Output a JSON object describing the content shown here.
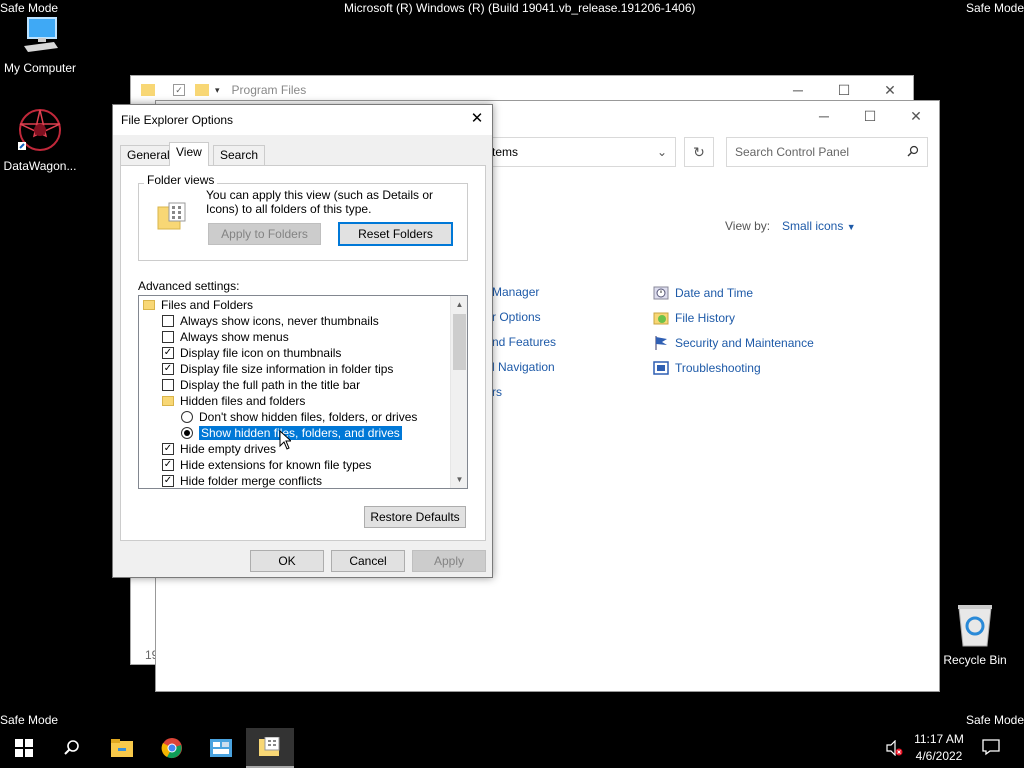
{
  "screen": {
    "top_title": "Microsoft (R) Windows (R) (Build 19041.vb_release.191206-1406)",
    "safe_mode": "Safe Mode"
  },
  "desktop": {
    "icons": [
      {
        "label": "My Computer",
        "icon": "computer-icon"
      },
      {
        "label": "DataWagon...",
        "icon": "app-shortcut-icon"
      },
      {
        "label": "Recycle Bin",
        "icon": "recycle-bin-icon"
      }
    ]
  },
  "explorer_window": {
    "title": "Program Files",
    "partial_bottom_text": "19"
  },
  "control_panel": {
    "address_partial": "tems",
    "search_placeholder": "Search Control Panel",
    "view_by_label": "View by:",
    "view_by_value": "Small icons",
    "left_items_partial": [
      "Manager",
      "r Options",
      "nd Features",
      "l Navigation",
      "rs"
    ],
    "right_items": [
      {
        "label": "Date and Time",
        "icon": "clock-icon"
      },
      {
        "label": "File History",
        "icon": "file-history-icon"
      },
      {
        "label": "Security and Maintenance",
        "icon": "flag-icon"
      },
      {
        "label": "Troubleshooting",
        "icon": "troubleshoot-icon"
      }
    ]
  },
  "dialog": {
    "title": "File Explorer Options",
    "tabs": [
      "General",
      "View",
      "Search"
    ],
    "active_tab": "View",
    "folder_views": {
      "legend": "Folder views",
      "description": "You can apply this view (such as Details or Icons) to all folders of this type.",
      "apply_button": "Apply to Folders",
      "reset_button": "Reset Folders"
    },
    "advanced_label": "Advanced settings:",
    "settings": [
      {
        "type": "folder",
        "label": "Files and Folders"
      },
      {
        "type": "checkbox",
        "label": "Always show icons, never thumbnails",
        "checked": false
      },
      {
        "type": "checkbox",
        "label": "Always show menus",
        "checked": false
      },
      {
        "type": "checkbox",
        "label": "Display file icon on thumbnails",
        "checked": true
      },
      {
        "type": "checkbox",
        "label": "Display file size information in folder tips",
        "checked": true
      },
      {
        "type": "checkbox",
        "label": "Display the full path in the title bar",
        "checked": false
      },
      {
        "type": "folder",
        "label": "Hidden files and folders"
      },
      {
        "type": "radio",
        "label": "Don't show hidden files, folders, or drives",
        "checked": false
      },
      {
        "type": "radio",
        "label": "Show hidden files, folders, and drives",
        "checked": true
      },
      {
        "type": "checkbox",
        "label": "Hide empty drives",
        "checked": true
      },
      {
        "type": "checkbox",
        "label": "Hide extensions for known file types",
        "checked": true
      },
      {
        "type": "checkbox",
        "label": "Hide folder merge conflicts",
        "checked": true
      }
    ],
    "restore_button": "Restore Defaults",
    "ok_button": "OK",
    "cancel_button": "Cancel",
    "apply_button": "Apply"
  },
  "taskbar": {
    "time": "11:17 AM",
    "date": "4/6/2022"
  }
}
